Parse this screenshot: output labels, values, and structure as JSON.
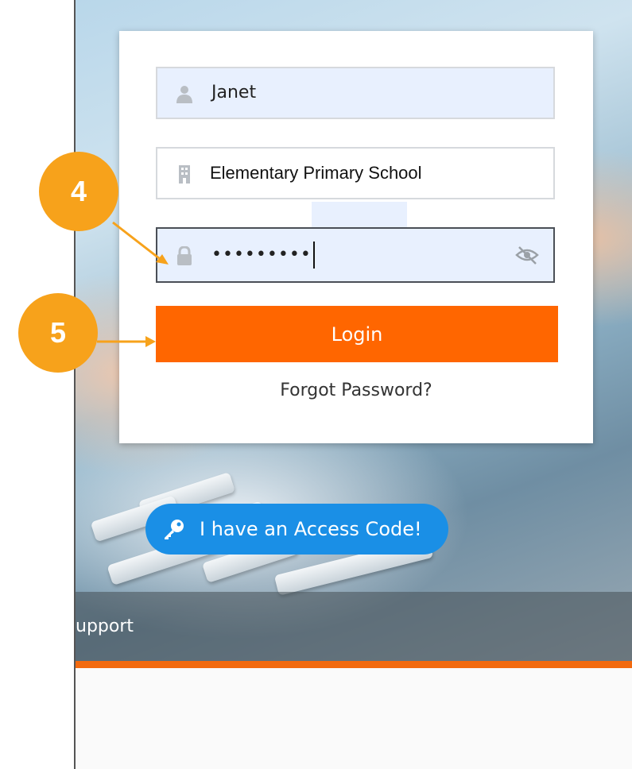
{
  "login_form": {
    "username_value": "Janet",
    "school_value": "Elementary Primary School",
    "password_value": "•••••••••",
    "login_label": "Login",
    "forgot_label": "Forgot Password?"
  },
  "access_code": {
    "label": "I have an Access Code!"
  },
  "footer": {
    "support_text": "upport"
  },
  "callouts": [
    {
      "number": "4"
    },
    {
      "number": "5"
    }
  ],
  "icons": {
    "username": "user-icon",
    "school": "building-icon",
    "password": "lock-icon",
    "visibility": "eye-slash-icon",
    "access": "key-icon"
  },
  "colors": {
    "accent_orange": "#ff6600",
    "access_blue": "#1a8fe6",
    "callout_orange": "#f7a21b"
  }
}
